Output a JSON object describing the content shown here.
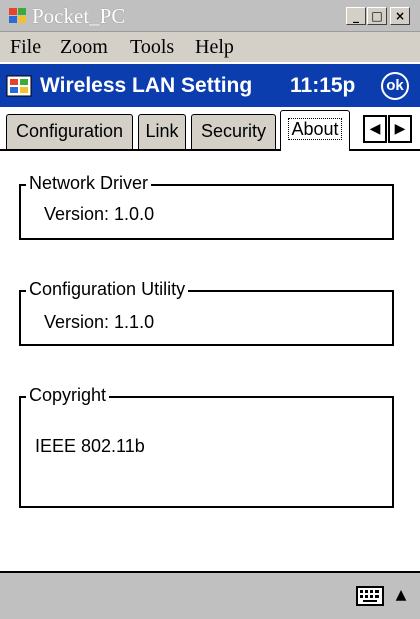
{
  "window": {
    "title": "Pocket_PC",
    "controls": {
      "minimize": "_",
      "maximize": "□",
      "close": "×"
    }
  },
  "menu": {
    "items": [
      "File",
      "Zoom",
      "Tools",
      "Help"
    ]
  },
  "navbar": {
    "title": "Wireless LAN Setting",
    "time": "11:15p",
    "ok_label": "ok",
    "color": "#0b3daf"
  },
  "tabs": {
    "items": [
      "Configuration",
      "Link",
      "Security",
      "About"
    ],
    "active": "About",
    "scroll_left": "◀",
    "scroll_right": "▶"
  },
  "groups": {
    "network_driver": {
      "legend": "Network Driver",
      "text": "Version: 1.0.0"
    },
    "config_utility": {
      "legend": "Configuration Utility",
      "text": "Version: 1.1.0"
    },
    "copyright": {
      "legend": "Copyright",
      "text": "IEEE 802.11b"
    }
  },
  "command_bar": {
    "input_icon": "keyboard-icon",
    "sip_arrow": "▲"
  }
}
